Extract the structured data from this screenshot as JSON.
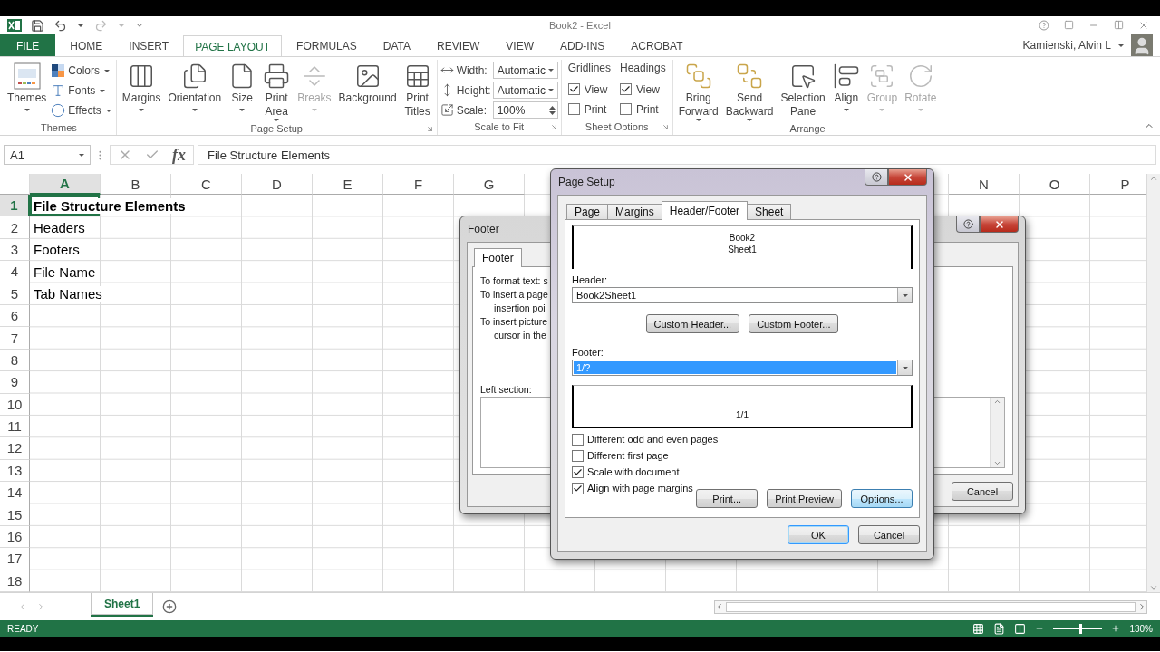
{
  "title_bar": {
    "title": "Book2 - Excel"
  },
  "ribbon_tabs": [
    {
      "label": "FILE",
      "kind": "file",
      "selected": false
    },
    {
      "label": "HOME",
      "kind": "tab",
      "selected": false
    },
    {
      "label": "INSERT",
      "kind": "tab",
      "selected": false
    },
    {
      "label": "PAGE LAYOUT",
      "kind": "tab",
      "selected": true
    },
    {
      "label": "FORMULAS",
      "kind": "tab",
      "selected": false
    },
    {
      "label": "DATA",
      "kind": "tab",
      "selected": false
    },
    {
      "label": "REVIEW",
      "kind": "tab",
      "selected": false
    },
    {
      "label": "VIEW",
      "kind": "tab",
      "selected": false
    },
    {
      "label": "ADD-INS",
      "kind": "tab",
      "selected": false
    },
    {
      "label": "ACROBAT",
      "kind": "tab",
      "selected": false
    }
  ],
  "user": {
    "name": "Kamienski, Alvin L"
  },
  "ribbon_groups": [
    {
      "title": "Themes",
      "kind": "buttons",
      "launcher": false,
      "items": [
        {
          "kind": "large",
          "lines": [
            "Themes"
          ],
          "dropdown": true,
          "disabled": false
        },
        {
          "kind": "stack",
          "buttons": [
            {
              "label": "Colors",
              "dropdown": true
            },
            {
              "label": "Fonts",
              "dropdown": true
            },
            {
              "label": "Effects",
              "dropdown": true
            }
          ]
        }
      ]
    },
    {
      "title": "Page Setup",
      "kind": "buttons",
      "launcher": true,
      "items": [
        {
          "kind": "large",
          "lines": [
            "Margins"
          ],
          "dropdown": true,
          "disabled": false
        },
        {
          "kind": "large",
          "lines": [
            "Orientation"
          ],
          "dropdown": true,
          "disabled": false
        },
        {
          "kind": "large",
          "lines": [
            "Size"
          ],
          "dropdown": true,
          "disabled": false
        },
        {
          "kind": "large",
          "lines": [
            "Print",
            "Area"
          ],
          "dropdown": true,
          "disabled": false
        },
        {
          "kind": "large",
          "lines": [
            "Breaks"
          ],
          "dropdown": true,
          "disabled": true
        },
        {
          "kind": "large",
          "lines": [
            "Background"
          ],
          "dropdown": false,
          "disabled": false
        },
        {
          "kind": "large",
          "lines": [
            "Print",
            "Titles"
          ],
          "dropdown": false,
          "disabled": false
        }
      ]
    },
    {
      "title": "Scale to Fit",
      "kind": "scale",
      "launcher": true,
      "rows": [
        {
          "label": "Width:",
          "value": "Automatic",
          "kind": "dropdown"
        },
        {
          "label": "Height:",
          "value": "Automatic",
          "kind": "dropdown"
        },
        {
          "label": "Scale:",
          "value": "100%",
          "kind": "spin"
        }
      ]
    },
    {
      "title": "Sheet Options",
      "kind": "options",
      "launcher": true,
      "columns": [
        {
          "title": "Gridlines",
          "checks": [
            {
              "label": "View",
              "checked": true
            },
            {
              "label": "Print",
              "checked": false
            }
          ]
        },
        {
          "title": "Headings",
          "checks": [
            {
              "label": "View",
              "checked": true
            },
            {
              "label": "Print",
              "checked": false
            }
          ]
        }
      ]
    },
    {
      "title": "Arrange",
      "kind": "buttons",
      "launcher": false,
      "items": [
        {
          "kind": "large",
          "lines": [
            "Bring",
            "Forward"
          ],
          "dropdown": true,
          "disabled": false
        },
        {
          "kind": "large",
          "lines": [
            "Send",
            "Backward"
          ],
          "dropdown": true,
          "disabled": false
        },
        {
          "kind": "large",
          "lines": [
            "Selection",
            "Pane"
          ],
          "dropdown": false,
          "disabled": false
        },
        {
          "kind": "large",
          "lines": [
            "Align"
          ],
          "dropdown": true,
          "disabled": false
        },
        {
          "kind": "large",
          "lines": [
            "Group"
          ],
          "dropdown": true,
          "disabled": true
        },
        {
          "kind": "large",
          "lines": [
            "Rotate"
          ],
          "dropdown": true,
          "disabled": true
        }
      ]
    }
  ],
  "formula_bar": {
    "name_box": "A1",
    "function_label": "fx",
    "value": "File Structure Elements"
  },
  "grid": {
    "columns_left": [
      {
        "label": "A",
        "selected": true
      },
      {
        "label": "B",
        "selected": false
      },
      {
        "label": "C",
        "selected": false
      },
      {
        "label": "D",
        "selected": false
      },
      {
        "label": "E",
        "selected": false
      },
      {
        "label": "F",
        "selected": false
      },
      {
        "label": "G",
        "selected": false
      }
    ],
    "columns_right": [
      {
        "label": "N",
        "selected": false
      },
      {
        "label": "O",
        "selected": false
      },
      {
        "label": "P",
        "selected": false
      }
    ],
    "rows": [
      {
        "number": "1",
        "selected": true,
        "cell_a": {
          "text": "File Structure Elements",
          "bold": true
        }
      },
      {
        "number": "2",
        "selected": false,
        "cell_a": {
          "text": "Headers",
          "bold": false
        }
      },
      {
        "number": "3",
        "selected": false,
        "cell_a": {
          "text": "Footers",
          "bold": false
        }
      },
      {
        "number": "4",
        "selected": false,
        "cell_a": {
          "text": "File Name",
          "bold": false
        }
      },
      {
        "number": "5",
        "selected": false,
        "cell_a": {
          "text": "Tab Names",
          "bold": false
        }
      },
      {
        "number": "6",
        "selected": false
      },
      {
        "number": "7",
        "selected": false
      },
      {
        "number": "8",
        "selected": false
      },
      {
        "number": "9",
        "selected": false
      },
      {
        "number": "10",
        "selected": false
      },
      {
        "number": "11",
        "selected": false
      },
      {
        "number": "12",
        "selected": false
      },
      {
        "number": "13",
        "selected": false
      },
      {
        "number": "14",
        "selected": false
      },
      {
        "number": "15",
        "selected": false
      },
      {
        "number": "16",
        "selected": false
      },
      {
        "number": "17",
        "selected": false
      },
      {
        "number": "18",
        "selected": false
      }
    ]
  },
  "sheet_tabs": [
    {
      "label": "Sheet1",
      "selected": true
    }
  ],
  "status_bar": {
    "mode": "READY",
    "zoom": "130%",
    "zoom_slider": {
      "level": 0.55
    }
  },
  "footer_dialog": {
    "title": "Footer",
    "tabs": [
      {
        "label": "Footer",
        "selected": true
      }
    ],
    "instructions": [
      {
        "first": "To format text:  s"
      },
      {
        "first": "To insert a page",
        "rest": "insertion poi"
      },
      {
        "first": "To insert picture",
        "rest": "cursor in the"
      }
    ],
    "left_section_label": "Left section:",
    "buttons": [
      {
        "label": "Cancel"
      }
    ]
  },
  "page_setup": {
    "title": "Page Setup",
    "tabs": [
      {
        "label": "Page",
        "selected": false
      },
      {
        "label": "Margins",
        "selected": false
      },
      {
        "label": "Header/Footer",
        "selected": true
      },
      {
        "label": "Sheet",
        "selected": false
      }
    ],
    "header_preview": [
      "Book2",
      "Sheet1"
    ],
    "header_label": "Header:",
    "header_value": "Book2Sheet1",
    "custom_buttons": [
      "Custom Header...",
      "Custom Footer..."
    ],
    "footer_label": "Footer:",
    "footer_value": "1/?",
    "footer_value_selected": true,
    "footer_preview": [
      "1/1"
    ],
    "options": [
      {
        "label": "Different odd and even pages",
        "checked": false
      },
      {
        "label": "Different first page",
        "checked": false
      },
      {
        "label": "Scale with document",
        "checked": true
      },
      {
        "label": "Align with page margins",
        "checked": true
      }
    ],
    "action_buttons": [
      {
        "label": "Print...",
        "hovered": false
      },
      {
        "label": "Print Preview",
        "hovered": false
      },
      {
        "label": "Options...",
        "hovered": true
      }
    ],
    "buttons": [
      {
        "label": "OK",
        "default": true
      },
      {
        "label": "Cancel",
        "default": false
      }
    ]
  }
}
